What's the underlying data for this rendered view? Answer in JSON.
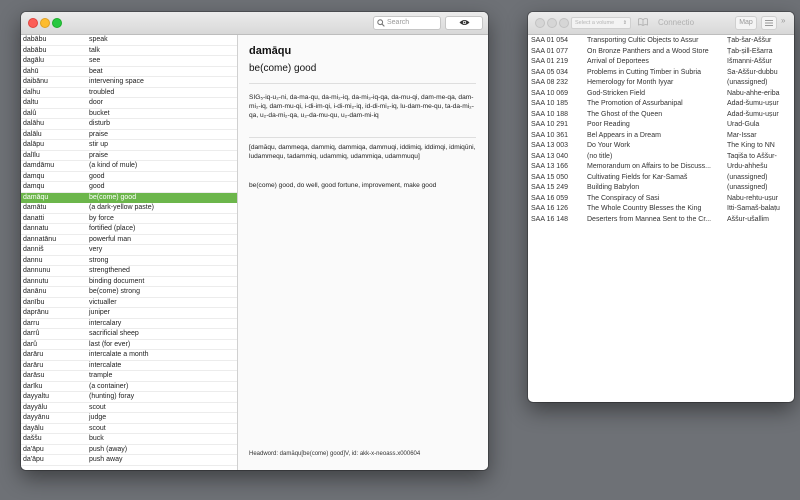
{
  "main": {
    "search_placeholder": "Search",
    "entries": [
      {
        "word": "dabābu",
        "meaning": "speak"
      },
      {
        "word": "dabābu",
        "meaning": "talk"
      },
      {
        "word": "dagālu",
        "meaning": "see"
      },
      {
        "word": "dahū",
        "meaning": "beat"
      },
      {
        "word": "daibānu",
        "meaning": "intervening space"
      },
      {
        "word": "dalhu",
        "meaning": "troubled"
      },
      {
        "word": "daltu",
        "meaning": "door"
      },
      {
        "word": "dalû",
        "meaning": "bucket"
      },
      {
        "word": "dalāhu",
        "meaning": "disturb"
      },
      {
        "word": "dalālu",
        "meaning": "praise"
      },
      {
        "word": "dalāpu",
        "meaning": "stir up"
      },
      {
        "word": "dalīlu",
        "meaning": "praise"
      },
      {
        "word": "damdāmu",
        "meaning": "(a kind of mule)"
      },
      {
        "word": "damqu",
        "meaning": "good"
      },
      {
        "word": "damqu",
        "meaning": "good"
      },
      {
        "word": "damāqu",
        "meaning": "be(come) good"
      },
      {
        "word": "damātu",
        "meaning": "(a dark-yellow paste)"
      },
      {
        "word": "danatti",
        "meaning": "by force"
      },
      {
        "word": "dannatu",
        "meaning": "fortified (place)"
      },
      {
        "word": "dannatānu",
        "meaning": "powerful man"
      },
      {
        "word": "danniš",
        "meaning": "very"
      },
      {
        "word": "dannu",
        "meaning": "strong"
      },
      {
        "word": "dannunu",
        "meaning": "strengthened"
      },
      {
        "word": "dannutu",
        "meaning": "binding document"
      },
      {
        "word": "danānu",
        "meaning": "be(come) strong"
      },
      {
        "word": "danību",
        "meaning": "victualler"
      },
      {
        "word": "daprānu",
        "meaning": "juniper"
      },
      {
        "word": "darru",
        "meaning": "intercalary"
      },
      {
        "word": "darrû",
        "meaning": "sacrificial sheep"
      },
      {
        "word": "darû",
        "meaning": "last (for ever)"
      },
      {
        "word": "darāru",
        "meaning": "intercalate a month"
      },
      {
        "word": "darāru",
        "meaning": "intercalate"
      },
      {
        "word": "darāsu",
        "meaning": "trample"
      },
      {
        "word": "darīku",
        "meaning": "(a container)"
      },
      {
        "word": "dayyaltu",
        "meaning": "(hunting) foray"
      },
      {
        "word": "dayyālu",
        "meaning": "scout"
      },
      {
        "word": "dayyānu",
        "meaning": "judge"
      },
      {
        "word": "dayālu",
        "meaning": "scout"
      },
      {
        "word": "daššu",
        "meaning": "buck"
      },
      {
        "word": "da'āpu",
        "meaning": "push (away)"
      },
      {
        "word": "da'āpu",
        "meaning": "push away"
      }
    ],
    "selected_index": 15,
    "detail": {
      "headword": "damāqu",
      "gloss": "be(come) good",
      "forms": "SIG₅-iq-u₂-ni, da-ma-qu, da-mi₂-iq, da-mi₃-iq-qa, da-mu-qi, dam-me-qa, dam-mi₂-iq, dam-mu-qi, i-di-im-qi, i-di-mi₂-iq, id-di-mi₂-iq, lu-dam-me-qu, ta-da-mi₂-qa, u₂-da-mi₂-qa, u₂-da-mu-qu, u₂-dam-mi-iq",
      "variants": "[damāqu, dammeqa, dammiq, dammiqa, dammuqi, iddimiq, iddimqi, idmiqūni, ludammequ, tadammiq, udammiq, udammiqa, udammuqu]",
      "senses": "be(come) good, do well, good fortune, improvement, make good",
      "footer": "Headword: damāqu[be(come) good]V, id: akk-x-neoass.x000604"
    }
  },
  "corpus": {
    "volume_placeholder": "Select a volume",
    "title": "Connectio",
    "map_label": "Map",
    "more_label": "»",
    "texts": [
      {
        "id": "SAA 01 054",
        "title": "Transporting Cultic Objects to Assur",
        "author": "Ṭab-šar-Aššur"
      },
      {
        "id": "SAA 01 077",
        "title": "On Bronze Panthers and a Wood Store",
        "author": "Ṭab-ṣill-Ešarra"
      },
      {
        "id": "SAA 01 219",
        "title": "Arrival of Deportees",
        "author": "Išmanni-Aššur"
      },
      {
        "id": "SAA 05 034",
        "title": "Problems in Cutting Timber in Šubria",
        "author": "Ša-Aššur-dubbu"
      },
      {
        "id": "SAA 08 232",
        "title": "Hemerology for Month Iyyar",
        "author": "(unassigned)"
      },
      {
        "id": "SAA 10 069",
        "title": "God-Stricken Field",
        "author": "Nabu-ahhe-eriba"
      },
      {
        "id": "SAA 10 185",
        "title": "The Promotion of Assurbanipal",
        "author": "Adad-šumu-uṣur"
      },
      {
        "id": "SAA 10 188",
        "title": "The Ghost of the Queen",
        "author": "Adad-šumu-uṣur"
      },
      {
        "id": "SAA 10 291",
        "title": "Poor Reading",
        "author": "Urad-Gula"
      },
      {
        "id": "SAA 10 361",
        "title": "Bel Appears in a Dream",
        "author": "Mar-Issar"
      },
      {
        "id": "SAA 13 003",
        "title": "Do Your Work",
        "author": "The King to NN"
      },
      {
        "id": "SAA 13 040",
        "title": "(no title)",
        "author": "Taqiša to Aššur-"
      },
      {
        "id": "SAA 13 166",
        "title": "Memorandum on Affairs to be Discuss...",
        "author": "Urdu-ahhešu"
      },
      {
        "id": "SAA 15 050",
        "title": "Cultivating Fields for Kar-Šamaš",
        "author": "(unassigned)"
      },
      {
        "id": "SAA 15 249",
        "title": "Building Babylon",
        "author": "(unassigned)"
      },
      {
        "id": "SAA 16 059",
        "title": "The Conspiracy of Sasi",
        "author": "Nabu-rehtu-uṣur"
      },
      {
        "id": "SAA 16 126",
        "title": "The Whole Country Blesses the King",
        "author": "Itti-Šamaš-balaṭu"
      },
      {
        "id": "SAA 16 148",
        "title": "Deserters from Mannea Sent to the Cr...",
        "author": "Aššur-ušallim"
      }
    ]
  }
}
